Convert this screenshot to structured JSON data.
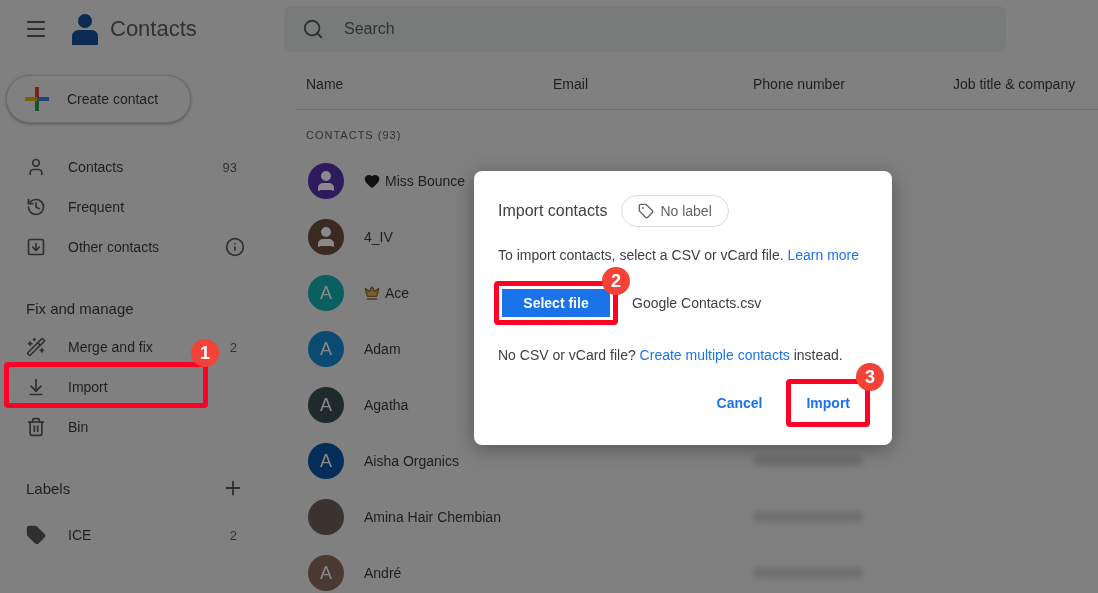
{
  "header": {
    "title": "Contacts",
    "search": {
      "placeholder": "Search"
    }
  },
  "create_button": "Create contact",
  "nav": [
    {
      "label": "Contacts",
      "count": "93"
    },
    {
      "label": "Frequent"
    },
    {
      "label": "Other contacts",
      "info": true
    }
  ],
  "fix_section": {
    "heading": "Fix and manage",
    "items": [
      {
        "label": "Merge and fix",
        "count": "2",
        "highlight": false
      },
      {
        "label": "Import",
        "highlight": true,
        "badge": "1"
      },
      {
        "label": "Bin",
        "highlight": false
      }
    ]
  },
  "labels_section": {
    "heading": "Labels",
    "items": [
      {
        "label": "ICE",
        "count": "2"
      }
    ]
  },
  "table": {
    "columns": [
      "Name",
      "Email",
      "Phone number",
      "Job title & company"
    ],
    "section": "CONTACTS (93)",
    "rows": [
      {
        "name": "Miss Bounce",
        "avatar": {
          "kind": "person",
          "color": "#2d1b5e"
        },
        "emoji": {
          "kind": "heart"
        },
        "phone_blurred": false
      },
      {
        "name": "4_IV",
        "avatar": {
          "kind": "person",
          "color": "#3a2a22"
        },
        "phone_blurred": false
      },
      {
        "name": "Ace",
        "avatar": {
          "kind": "letter",
          "initial": "A",
          "color": "#0a5f60"
        },
        "emoji": {
          "kind": "crown"
        },
        "phone_blurred": false
      },
      {
        "name": "Adam",
        "avatar": {
          "kind": "letter",
          "initial": "A",
          "color": "#0b4b72"
        },
        "phone_blurred": false
      },
      {
        "name": "Agatha",
        "avatar": {
          "kind": "letter",
          "initial": "A",
          "color": "#1f2a2c"
        },
        "phone_blurred": false
      },
      {
        "name": "Aisha Organics",
        "avatar": {
          "kind": "letter",
          "initial": "A",
          "color": "#042d5a"
        },
        "phone_blurred": true
      },
      {
        "name": "Amina Hair Chembian",
        "avatar": {
          "kind": "photo",
          "color": "#3a3330"
        },
        "phone_blurred": true
      },
      {
        "name": "André",
        "avatar": {
          "kind": "letter",
          "initial": "A",
          "color": "#4a3a33"
        },
        "phone_blurred": true
      }
    ]
  },
  "dialog": {
    "title": "Import contacts",
    "label_chip": "No label",
    "text": "To import contacts, select a CSV or vCard file.",
    "link": "Learn more",
    "select_button": {
      "label": "Select file",
      "highlight": true,
      "badge": "2"
    },
    "file_name": "Google Contacts.csv",
    "note": {
      "before": "No CSV or vCard file?",
      "link": "Create multiple contacts",
      "after": "instead."
    },
    "buttons": [
      {
        "label": "Cancel",
        "highlight": false
      },
      {
        "label": "Import",
        "highlight": true,
        "badge": "3"
      }
    ]
  }
}
